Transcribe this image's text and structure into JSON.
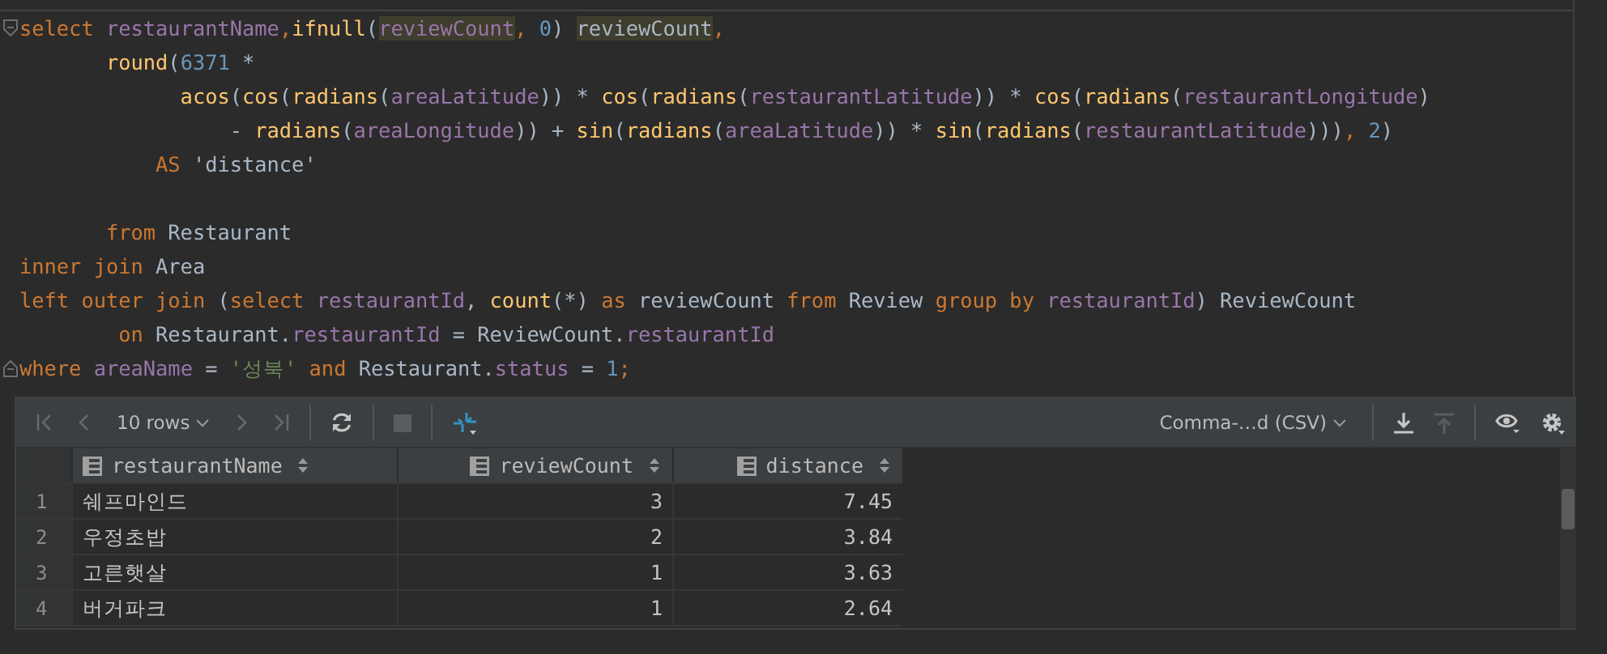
{
  "editor": {
    "lines": [
      {
        "kind": "fold-start",
        "tokens": [
          {
            "kind": "kw",
            "text": "select "
          },
          {
            "kind": "col",
            "text": "restaurantName"
          },
          {
            "kind": "kw",
            "text": ","
          },
          {
            "kind": "fn",
            "text": "ifnull"
          },
          {
            "kind": "p",
            "text": "("
          },
          {
            "kind": "col",
            "text": "reviewCount",
            "highlighted": true
          },
          {
            "kind": "kw",
            "text": ", "
          },
          {
            "kind": "num",
            "text": "0"
          },
          {
            "kind": "p",
            "text": ") "
          },
          {
            "kind": "id",
            "text": "reviewCount",
            "highlighted": true
          },
          {
            "kind": "kw",
            "text": ","
          }
        ]
      },
      {
        "kind": "code",
        "tokens": [
          {
            "kind": "fn",
            "text": "       round"
          },
          {
            "kind": "p",
            "text": "("
          },
          {
            "kind": "num",
            "text": "6371"
          },
          {
            "kind": "p",
            "text": " *"
          }
        ]
      },
      {
        "kind": "code",
        "tokens": [
          {
            "kind": "fn",
            "text": "             acos"
          },
          {
            "kind": "p",
            "text": "("
          },
          {
            "kind": "fn",
            "text": "cos"
          },
          {
            "kind": "p",
            "text": "("
          },
          {
            "kind": "fn",
            "text": "radians"
          },
          {
            "kind": "p",
            "text": "("
          },
          {
            "kind": "col",
            "text": "areaLatitude"
          },
          {
            "kind": "p",
            "text": ")) * "
          },
          {
            "kind": "fn",
            "text": "cos"
          },
          {
            "kind": "p",
            "text": "("
          },
          {
            "kind": "fn",
            "text": "radians"
          },
          {
            "kind": "p",
            "text": "("
          },
          {
            "kind": "col",
            "text": "restaurantLatitude"
          },
          {
            "kind": "p",
            "text": ")) * "
          },
          {
            "kind": "fn",
            "text": "cos"
          },
          {
            "kind": "p",
            "text": "("
          },
          {
            "kind": "fn",
            "text": "radians"
          },
          {
            "kind": "p",
            "text": "("
          },
          {
            "kind": "col",
            "text": "restaurantLongitude"
          },
          {
            "kind": "p",
            "text": ")"
          }
        ]
      },
      {
        "kind": "code",
        "tokens": [
          {
            "kind": "p",
            "text": "                 - "
          },
          {
            "kind": "fn",
            "text": "radians"
          },
          {
            "kind": "p",
            "text": "("
          },
          {
            "kind": "col",
            "text": "areaLongitude"
          },
          {
            "kind": "p",
            "text": ")) + "
          },
          {
            "kind": "fn",
            "text": "sin"
          },
          {
            "kind": "p",
            "text": "("
          },
          {
            "kind": "fn",
            "text": "radians"
          },
          {
            "kind": "p",
            "text": "("
          },
          {
            "kind": "col",
            "text": "areaLatitude"
          },
          {
            "kind": "p",
            "text": ")) * "
          },
          {
            "kind": "fn",
            "text": "sin"
          },
          {
            "kind": "p",
            "text": "("
          },
          {
            "kind": "fn",
            "text": "radians"
          },
          {
            "kind": "p",
            "text": "("
          },
          {
            "kind": "col",
            "text": "restaurantLatitude"
          },
          {
            "kind": "p",
            "text": ")))"
          },
          {
            "kind": "kw",
            "text": ", "
          },
          {
            "kind": "num",
            "text": "2"
          },
          {
            "kind": "p",
            "text": ")"
          }
        ]
      },
      {
        "kind": "code",
        "tokens": [
          {
            "kind": "kw",
            "text": "           AS "
          },
          {
            "kind": "id",
            "text": "'distance'"
          }
        ]
      },
      {
        "kind": "blank"
      },
      {
        "kind": "code",
        "tokens": [
          {
            "kind": "kw",
            "text": "       from "
          },
          {
            "kind": "id",
            "text": "Restaurant"
          }
        ]
      },
      {
        "kind": "code",
        "tokens": [
          {
            "kind": "kw",
            "text": "inner join "
          },
          {
            "kind": "id",
            "text": "Area"
          }
        ]
      },
      {
        "kind": "code",
        "tokens": [
          {
            "kind": "kw",
            "text": "left outer join "
          },
          {
            "kind": "p",
            "text": "("
          },
          {
            "kind": "kw",
            "text": "select "
          },
          {
            "kind": "col",
            "text": "restaurantId"
          },
          {
            "kind": "p",
            "text": ", "
          },
          {
            "kind": "fn",
            "text": "count"
          },
          {
            "kind": "p",
            "text": "(*) "
          },
          {
            "kind": "kw",
            "text": "as "
          },
          {
            "kind": "id",
            "text": "reviewCount "
          },
          {
            "kind": "kw",
            "text": "from "
          },
          {
            "kind": "id",
            "text": "Review "
          },
          {
            "kind": "kw",
            "text": "group by "
          },
          {
            "kind": "col",
            "text": "restaurantId"
          },
          {
            "kind": "p",
            "text": ") "
          },
          {
            "kind": "id",
            "text": "ReviewCount"
          }
        ]
      },
      {
        "kind": "code",
        "tokens": [
          {
            "kind": "kw",
            "text": "        on "
          },
          {
            "kind": "id",
            "text": "Restaurant."
          },
          {
            "kind": "col",
            "text": "restaurantId"
          },
          {
            "kind": "p",
            "text": " = "
          },
          {
            "kind": "id",
            "text": "ReviewCount."
          },
          {
            "kind": "col",
            "text": "restaurantId"
          }
        ]
      },
      {
        "kind": "fold-end",
        "tokens": [
          {
            "kind": "kw",
            "text": "where "
          },
          {
            "kind": "col",
            "text": "areaName"
          },
          {
            "kind": "p",
            "text": " = "
          },
          {
            "kind": "str",
            "text": "'성북'"
          },
          {
            "kind": "kw",
            "text": " and "
          },
          {
            "kind": "id",
            "text": "Restaurant."
          },
          {
            "kind": "col",
            "text": "status"
          },
          {
            "kind": "p",
            "text": " = "
          },
          {
            "kind": "num",
            "text": "1"
          },
          {
            "kind": "kw",
            "text": ";"
          }
        ]
      }
    ]
  },
  "results": {
    "toolbar_left": [
      {
        "kind": "first",
        "disabled": true
      },
      {
        "kind": "prev",
        "disabled": true
      },
      {
        "kind": "page-size",
        "label": "10 rows"
      },
      {
        "kind": "next",
        "disabled": true
      },
      {
        "kind": "last",
        "disabled": true
      },
      {
        "kind": "separator"
      },
      {
        "kind": "refresh",
        "disabled": false
      },
      {
        "kind": "separator"
      },
      {
        "kind": "stop",
        "disabled": true
      },
      {
        "kind": "separator"
      },
      {
        "kind": "compare",
        "disabled": false
      }
    ],
    "toolbar_right": [
      {
        "kind": "format",
        "label": "Comma-…d (CSV)"
      },
      {
        "kind": "separator"
      },
      {
        "kind": "download",
        "disabled": false
      },
      {
        "kind": "upload",
        "disabled": true
      },
      {
        "kind": "separator"
      },
      {
        "kind": "view",
        "disabled": false
      },
      {
        "kind": "settings",
        "disabled": false
      }
    ],
    "table": {
      "columns": [
        {
          "label": "restaurantName",
          "kind": "text"
        },
        {
          "label": "reviewCount",
          "kind": "number"
        },
        {
          "label": "distance",
          "kind": "number"
        }
      ],
      "rows": [
        {
          "number": "1",
          "cells": [
            "쉐프마인드",
            "3",
            "7.45"
          ]
        },
        {
          "number": "2",
          "cells": [
            "우정초밥",
            "2",
            "3.84"
          ]
        },
        {
          "number": "3",
          "cells": [
            "고른햇살",
            "1",
            "3.63"
          ]
        },
        {
          "number": "4",
          "cells": [
            "버거파크",
            "1",
            "2.64"
          ]
        }
      ]
    }
  }
}
